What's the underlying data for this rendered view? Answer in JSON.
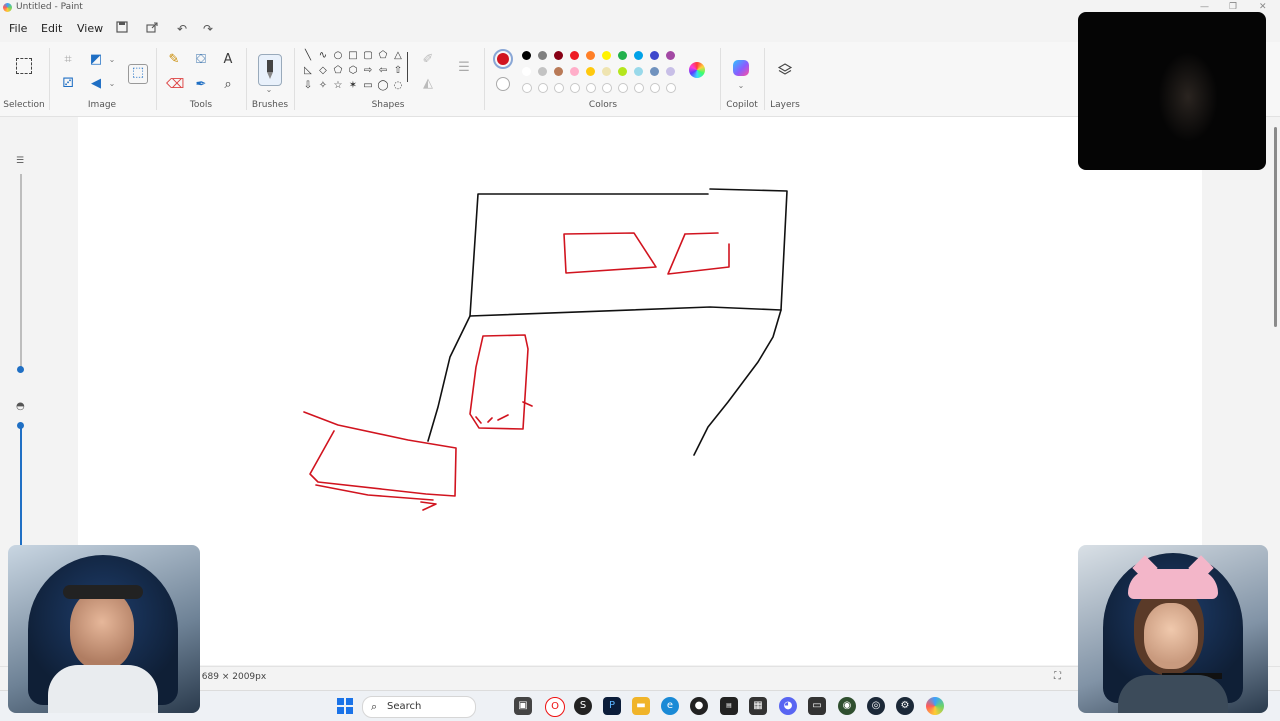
{
  "window": {
    "title": "Untitled - Paint"
  },
  "menu": {
    "file": "File",
    "edit": "Edit",
    "view": "View"
  },
  "ribbon": {
    "groups": {
      "selection": "Selection",
      "image": "Image",
      "tools": "Tools",
      "brushes": "Brushes",
      "shapes": "Shapes",
      "colors": "Colors",
      "copilot": "Copilot",
      "layers": "Layers"
    },
    "tools": {
      "text_icon": "A"
    }
  },
  "colors": {
    "primary": "#d1141f",
    "row1": [
      "#000000",
      "#7f7f7f",
      "#880015",
      "#ed1c24",
      "#ff7f27",
      "#fff200",
      "#22b14c",
      "#00a2e8",
      "#3f48cc",
      "#a349a4"
    ],
    "row2": [
      "#ffffff",
      "#c3c3c3",
      "#b97a57",
      "#ffaec9",
      "#ffc90e",
      "#efe4b0",
      "#b5e61d",
      "#99d9ea",
      "#7092be",
      "#c8bfe7"
    ]
  },
  "status": {
    "canvas_size": " 689 × 2009px"
  },
  "taskbar": {
    "search_label": "Search"
  }
}
